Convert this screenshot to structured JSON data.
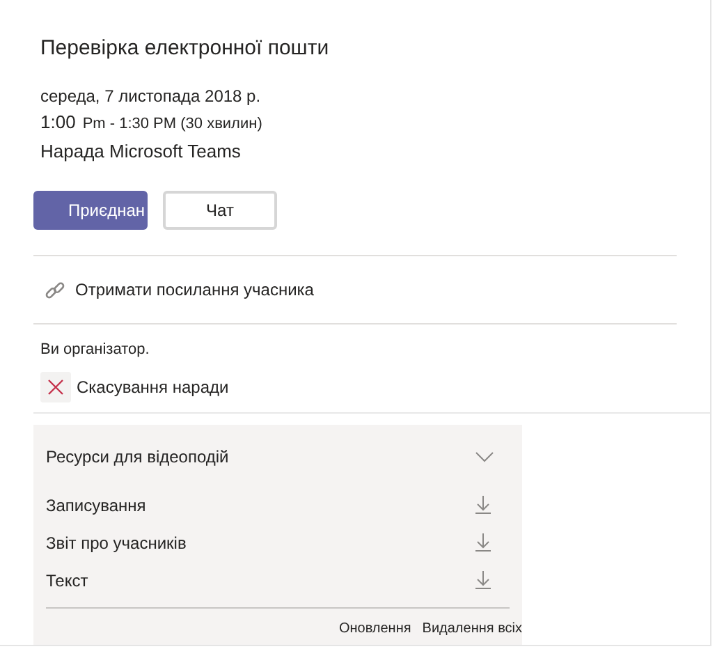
{
  "title": "Перевірка електронної пошти",
  "date": "середа, 7 листопада 2018 р.",
  "time_start": "1:00",
  "time_rest": "Pm - 1:30 PM (30 хвилин)",
  "meeting_type": "Нарада Microsoft Teams",
  "buttons": [
    {
      "label": "Приєднан",
      "kind": "primary"
    },
    {
      "label": "Чат",
      "kind": "secondary"
    }
  ],
  "link_action": "Отримати посилання учасника",
  "organizer_note": "Ви організатор.",
  "cancel_action": "Скасування наради",
  "resources": {
    "title": "Ресурси для відеоподій",
    "expanded": true,
    "items": [
      {
        "label": "Записування"
      },
      {
        "label": "Звіт про учасників"
      },
      {
        "label": "Текст"
      }
    ],
    "footer_actions": [
      "Оновлення",
      "Видалення всіх"
    ]
  }
}
